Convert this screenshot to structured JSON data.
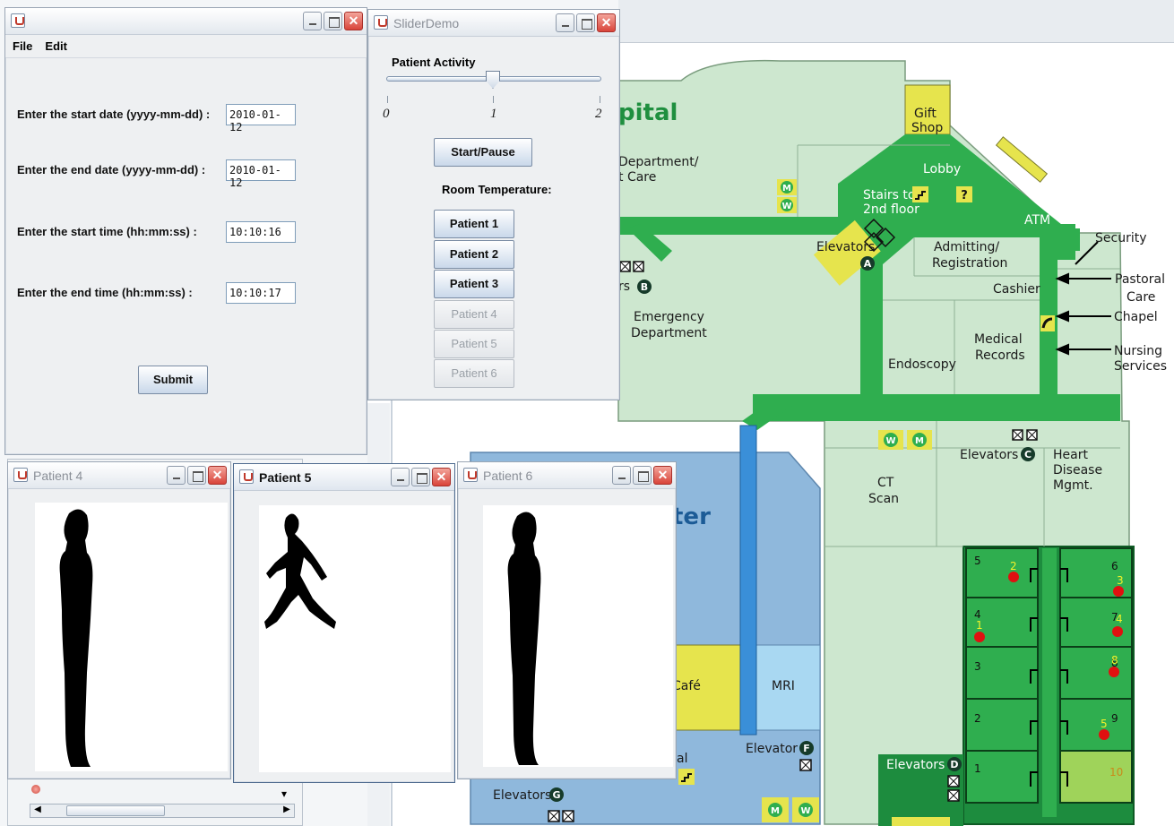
{
  "map": {
    "hospital_fragment": "pital",
    "center_fragment": "ter",
    "labels": {
      "gift_shop_1": "Gift",
      "gift_shop_2": "Shop",
      "lobby": "Lobby",
      "dept_1": "Department/",
      "dept_2": "t Care",
      "stairs_1": "Stairs to",
      "stairs_2": "2nd floor",
      "atm": "ATM",
      "security": "Security",
      "elevators_a": "Elevators",
      "admitting_1": "Admitting/",
      "admitting_2": "Registration",
      "stairs_b": "rs",
      "pastoral_1": "Pastoral",
      "pastoral_2": "Care",
      "cashier": "Cashier",
      "emergency_1": "Emergency",
      "emergency_2": "Department",
      "chapel": "Chapel",
      "medical_1": "Medical",
      "medical_2": "Records",
      "nursing_1": "Nursing",
      "nursing_2": "Services",
      "endoscopy": "Endoscopy",
      "elevators_c": "Elevators",
      "heart_1": "Heart",
      "heart_2": "Disease",
      "heart_3": "Mgmt.",
      "ct_1": "CT",
      "ct_2": "Scan",
      "cafe": "Café",
      "mri": "MRI",
      "elevator_f": "Elevator",
      "elevators_d": "Elevators",
      "elevators_g": "Elevators",
      "al_fragment": "al"
    },
    "badges": {
      "a": "A",
      "b": "B",
      "c": "C",
      "d": "D",
      "f": "F",
      "g": "G",
      "m": "M",
      "w": "W",
      "q": "?"
    },
    "rooms": {
      "left": [
        "5",
        "4",
        "3",
        "2",
        "1"
      ],
      "right": [
        "6",
        "7",
        "8",
        "9",
        "10"
      ],
      "patient_markers": [
        "2",
        "1",
        "3",
        "4",
        "8",
        "5"
      ]
    }
  },
  "form_window": {
    "menu": {
      "file": "File",
      "edit": "Edit"
    },
    "start_date_label": "Enter the start date (yyyy-mm-dd) :",
    "start_date_value": "2010-01-12",
    "end_date_label": "Enter the end date (yyyy-mm-dd) :",
    "end_date_value": "2010-01-12",
    "start_time_label": "Enter the start time (hh:mm:ss) :",
    "start_time_value": "10:10:16",
    "end_time_label": "Enter the end time (hh:mm:ss) :",
    "end_time_value": "10:10:17",
    "submit": "Submit"
  },
  "slider_window": {
    "title": "SliderDemo",
    "activity_label": "Patient Activity",
    "slider": {
      "min": "0",
      "mid": "1",
      "max": "2",
      "value": 1
    },
    "start_pause": "Start/Pause",
    "room_temp_label": "Room Temperature:",
    "patients": [
      "Patient 1",
      "Patient 2",
      "Patient 3",
      "Patient 4",
      "Patient 5",
      "Patient 6"
    ]
  },
  "patient_windows": {
    "p4_title": "Patient 4",
    "p5_title": "Patient 5",
    "p6_title": "Patient 6"
  },
  "colors": {
    "map_light_green": "#cde7cf",
    "map_corridor_green": "#2fae4f",
    "map_dark_green": "#1d8c3e",
    "map_yellow": "#e6e44d",
    "map_blue": "#8fb8dc",
    "map_mri_blue": "#a9d8f2",
    "marker_red": "#e01010"
  }
}
